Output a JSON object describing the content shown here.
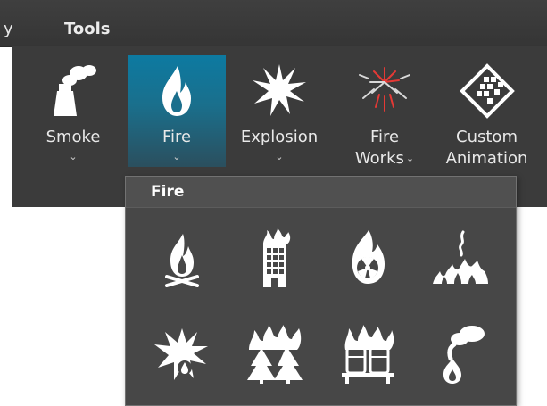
{
  "menu": {
    "partial_item": "y",
    "tools": "Tools"
  },
  "ribbon": {
    "buttons": [
      {
        "label": "Smoke",
        "icon": "smoke-stack-icon",
        "has_dropdown": true
      },
      {
        "label": "Fire",
        "icon": "fire-icon",
        "has_dropdown": true,
        "active": true
      },
      {
        "label": "Explosion",
        "icon": "explosion-icon",
        "has_dropdown": true
      },
      {
        "label_line1": "Fire",
        "label_line2": "Works",
        "icon": "fireworks-icon",
        "has_dropdown": true
      },
      {
        "label_line1": "Custom",
        "label_line2": "Animation",
        "icon": "custom-animation-icon",
        "has_dropdown": false
      }
    ],
    "chevron": "⌄"
  },
  "dropdown": {
    "title": "Fire",
    "items": [
      "campfire-icon",
      "burning-building-icon",
      "fire-radiation-icon",
      "ground-fire-icon",
      "explosion-fire-icon",
      "forest-fire-icon",
      "burning-barrels-icon",
      "smoke-fire-icon"
    ]
  },
  "colors": {
    "active_tab": "#1a7fa3",
    "ribbon_bg": "#3b3b3b",
    "dropdown_bg": "#474747",
    "icon_white": "#ffffff",
    "firework_red": "#e53935"
  }
}
